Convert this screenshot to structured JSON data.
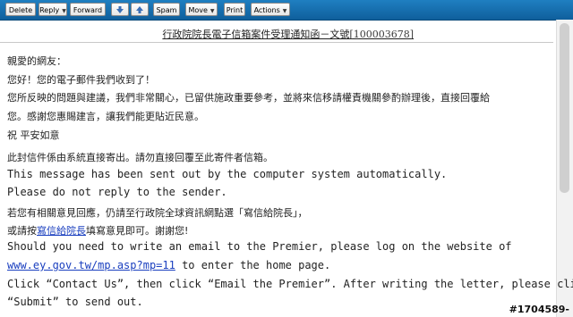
{
  "toolbar": {
    "delete": "Delete",
    "reply": "Reply",
    "forward": "Forward",
    "spam": "Spam",
    "move": "Move",
    "print": "Print",
    "actions": "Actions",
    "dropdown_glyph": "▼",
    "icons": [
      "arrow-down-icon",
      "arrow-up-icon"
    ]
  },
  "message": {
    "subject": "行政院院長電子信箱案件受理通知函－文號",
    "case_number": "[100003678]",
    "body": {
      "greeting": "親愛的網友：",
      "l1": "您好！您的電子郵件我們收到了！",
      "l2": "您所反映的問題與建議，我們非常關心，已留供施政重要參考，並將來信移請權責機關參酌辦理後，直接回覆給",
      "l3": "您。感謝您惠賜建言，讓我們能更貼近民意。",
      "l4": "祝 平安如意",
      "l5": "此封信件係由系統直接寄出。請勿直接回覆至此寄件者信箱。",
      "l6": "This message has been sent out by the computer system automatically.",
      "l7": "Please do not reply to the sender.",
      "l8": "若您有相關意見回應，仍請至行政院全球資訊網點選「寫信給院長」，",
      "l9_pre": "或請按",
      "l9_link": "寫信給院長",
      "l9_post": "填寫意見即可。謝謝您!",
      "l10": "Should you need to write an email to the Premier, please log on the website of",
      "l11_link": "www.ey.gov.tw/mp.asp?mp=11",
      "l11_post": " to enter the home page.",
      "l12": "Click “Contact Us”, then click “Email the Premier”. After writing the letter, please click",
      "l13": "“Submit” to send out."
    }
  },
  "watermark": "#1704589-"
}
